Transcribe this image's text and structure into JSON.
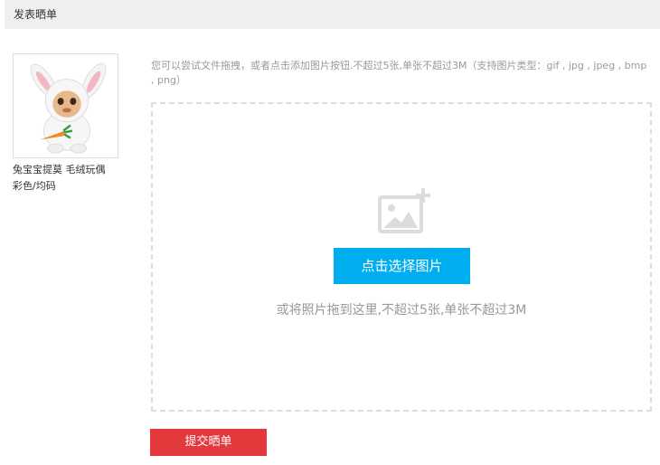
{
  "header": {
    "title": "发表晒单"
  },
  "product": {
    "image_icon": "plush-bunny-toy-image",
    "name": "兔宝宝提莫 毛绒玩偶",
    "spec": "彩色/均码"
  },
  "upload": {
    "hint": "您可以尝试文件拖拽，或者点击添加图片按钮.不超过5张,单张不超过3M（支持图片类型：gif , jpg , jpeg , bmp , png）",
    "icon": "add-image-icon",
    "select_button_label": "点击选择图片",
    "drop_hint": "或将照片拖到这里,不超过5张,单张不超过3M"
  },
  "submit": {
    "label": "提交晒单"
  },
  "colors": {
    "header_bg": "#f0f0f0",
    "select_button": "#00aeef",
    "submit_button": "#e4393c",
    "dashed_border": "#dddddd",
    "muted_text": "#999999"
  }
}
